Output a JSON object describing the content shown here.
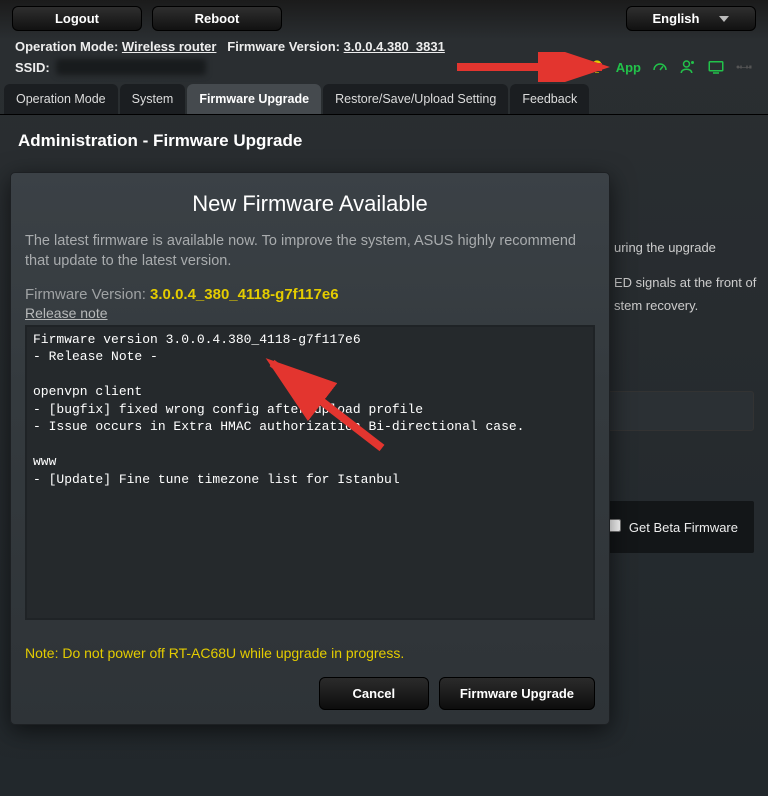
{
  "topbar": {
    "logout": "Logout",
    "reboot": "Reboot",
    "language": "English"
  },
  "info": {
    "op_mode_label": "Operation Mode:",
    "op_mode_value": "Wireless router",
    "fw_label": "Firmware Version:",
    "fw_value": "3.0.0.4.380_3831",
    "ssid_label": "SSID:",
    "app_label": "App"
  },
  "tabs": [
    "Operation Mode",
    "System",
    "Firmware Upgrade",
    "Restore/Save/Upload Setting",
    "Feedback"
  ],
  "active_tab": 2,
  "page_title": "Administration - Firmware Upgrade",
  "bg": {
    "line1": "uring the upgrade",
    "line2": "ED signals at the front of",
    "line3": "stem recovery.",
    "beta_label": "Get Beta Firmware"
  },
  "modal": {
    "title": "New Firmware Available",
    "desc": "The latest firmware is available now. To improve the system, ASUS highly recommend that update to the latest version.",
    "fw_label": "Firmware Version:",
    "fw_value": "3.0.0.4_380_4118-g7f117e6",
    "release_link": "Release note",
    "notes": "Firmware version 3.0.0.4.380_4118-g7f117e6\n- Release Note -\n\nopenvpn client\n- [bugfix] fixed wrong config after upload profile\n- Issue occurs in Extra HMAC authorization Bi-directional case.\n\nwww\n- [Update] Fine tune timezone list for Istanbul",
    "warn": "Note: Do not power off RT-AC68U while upgrade in progress.",
    "cancel": "Cancel",
    "upgrade": "Firmware Upgrade"
  }
}
